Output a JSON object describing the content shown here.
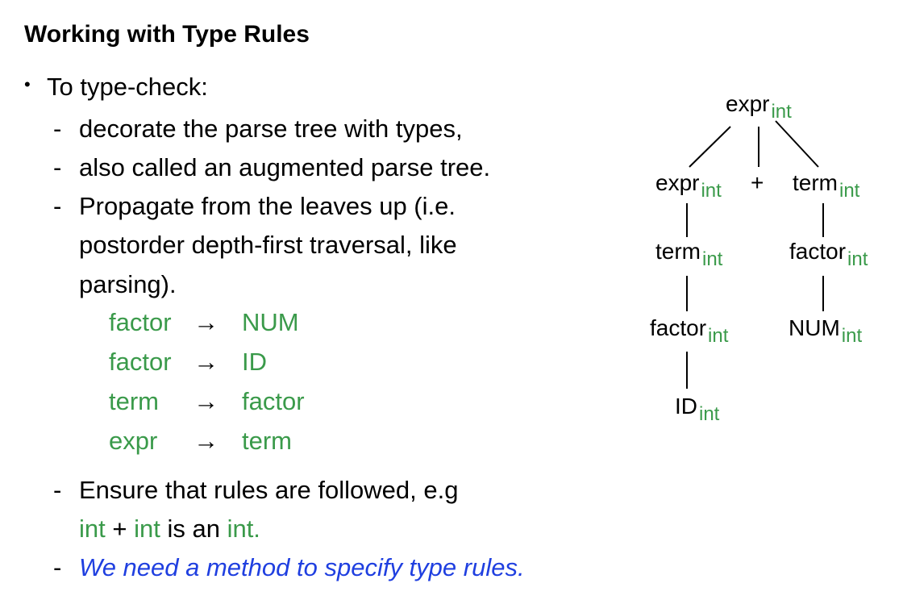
{
  "slide": {
    "title": "Working with Type Rules",
    "bullet_glyph": "•",
    "main_point": "To type-check:",
    "dash": "-",
    "sub1": "decorate the parse tree with types,",
    "sub2": "also called an augmented parse tree.",
    "sub3_line1": "Propagate from the leaves up (i.e.",
    "sub3_line2": "postorder depth-first traversal, like",
    "sub3_line3": "parsing).",
    "arrow": "→",
    "rules": [
      {
        "lhs": "factor",
        "rhs": "NUM"
      },
      {
        "lhs": "factor",
        "rhs": "ID"
      },
      {
        "lhs": "term",
        "rhs": "factor"
      },
      {
        "lhs": "expr",
        "rhs": "term"
      }
    ],
    "sub4_line1": "Ensure that rules are followed,  e.g",
    "sub4_int_a": "int",
    "sub4_plus": " + ",
    "sub4_int_b": "int",
    "sub4_is_an": " is an ",
    "sub4_int_c": "int.",
    "sub5": "We need a method to specify type rules."
  },
  "tree": {
    "type_label": "int",
    "plus": "+",
    "nodes": {
      "root": "expr",
      "left_expr": "expr",
      "right_term": "term",
      "left_term": "term",
      "right_factor": "factor",
      "left_factor": "factor",
      "num": "NUM",
      "id": "ID"
    }
  },
  "colors": {
    "green": "#3a9a4a",
    "blue": "#1f3fe0",
    "text": "#000000"
  }
}
